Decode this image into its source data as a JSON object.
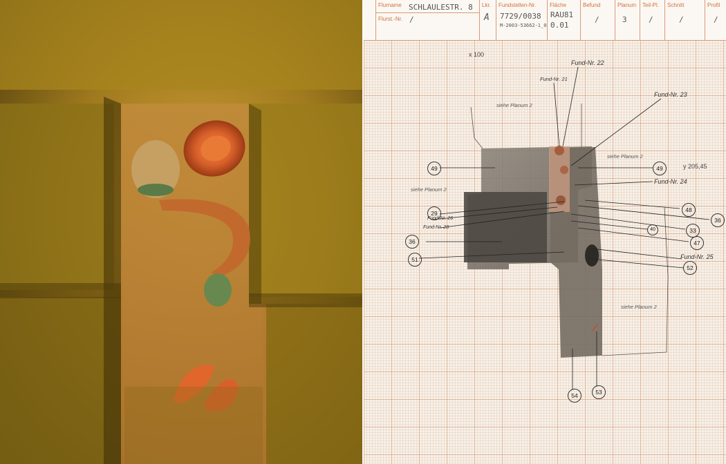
{
  "header": {
    "flurname_label": "Flurname",
    "flurname_value": "SCHLAULESTR. 8",
    "flurst_label": "Flurst.-Nr.",
    "flurst_value": "/",
    "lkr_label": "Lkr.",
    "lkr_value": "A",
    "fundstellen_label": "Fundstellen-Nr.",
    "fundstellen_value": "7729/0038",
    "fundstellen_sub": "M-2003-53662-1_0",
    "flaeche_label": "Fläche",
    "flaeche_value1": "RAU81",
    "flaeche_value2": "0.01",
    "befund_label": "Befund",
    "befund_value": "/",
    "planum_label": "Planum",
    "planum_value": "3",
    "teilpl_label": "Teil-Pl.",
    "teilpl_value": "/",
    "schnitt_label": "Schnitt",
    "schnitt_value": "/",
    "profil_label": "Profil",
    "profil_value": "/"
  },
  "drawing": {
    "x_coord": "x 100",
    "y_coord": "y 205,45",
    "notes": [
      "siehe Planum 2",
      "siehe Planum 2",
      "siehe Planum 2",
      "siehe Planum 2"
    ],
    "fund_labels": [
      "Fund-Nr. 22",
      "Fund-Nr. 21",
      "Fund-Nr. 23",
      "Fund-Nr. 24",
      "Fund-Nr. 26",
      "Fund-Nr. 28",
      "Fund-Nr. 25"
    ],
    "circles": [
      "49",
      "49",
      "48",
      "36",
      "29",
      "33",
      "40",
      "47",
      "36",
      "51",
      "52",
      "54",
      "53"
    ]
  }
}
